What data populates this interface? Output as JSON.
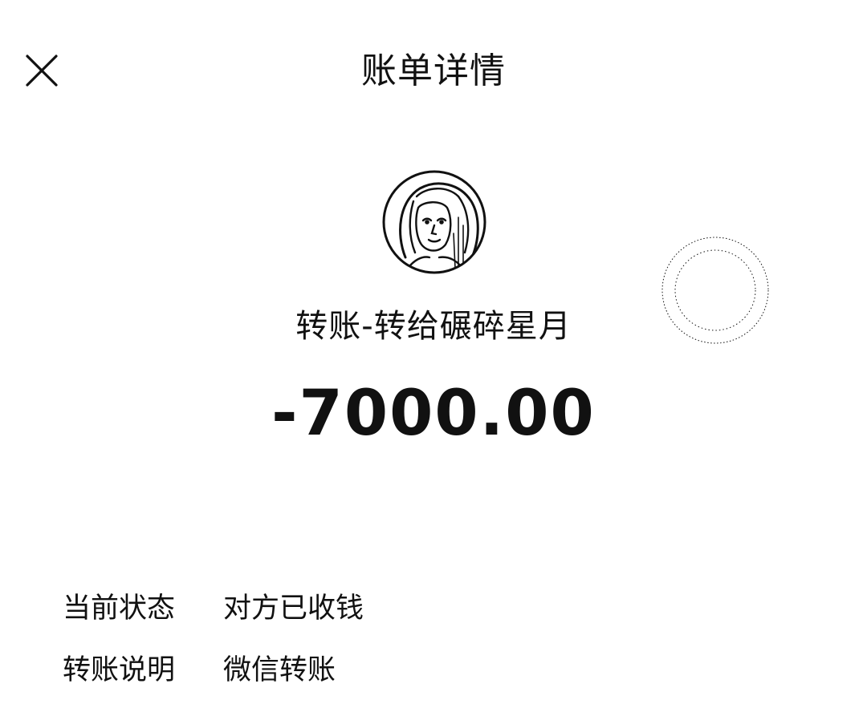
{
  "header": {
    "title": "账单详情",
    "close_icon": "close-icon"
  },
  "payee": {
    "avatar_icon": "avatar"
  },
  "transaction": {
    "title": "转账-转给碾碎星月",
    "amount": "-7000.00"
  },
  "details": [
    {
      "label": "当前状态",
      "value": "对方已收钱"
    },
    {
      "label": "转账说明",
      "value": "微信转账"
    }
  ],
  "colors": {
    "text": "#111111",
    "background": "#ffffff"
  }
}
